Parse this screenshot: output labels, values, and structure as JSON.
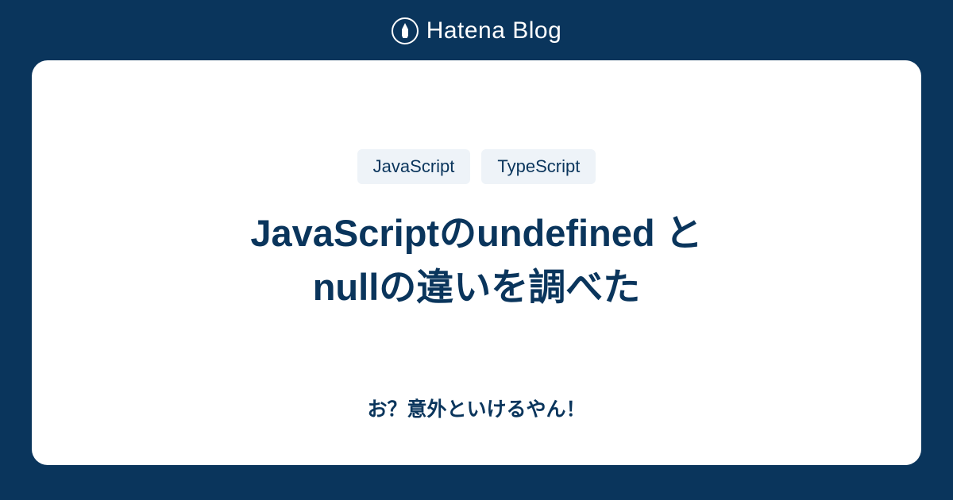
{
  "header": {
    "brand": "Hatena Blog"
  },
  "card": {
    "tags": [
      "JavaScript",
      "TypeScript"
    ],
    "title_line1": "JavaScriptのundefined と",
    "title_line2": "nullの違いを調べた",
    "subtitle": "お？意外といけるやん！"
  }
}
